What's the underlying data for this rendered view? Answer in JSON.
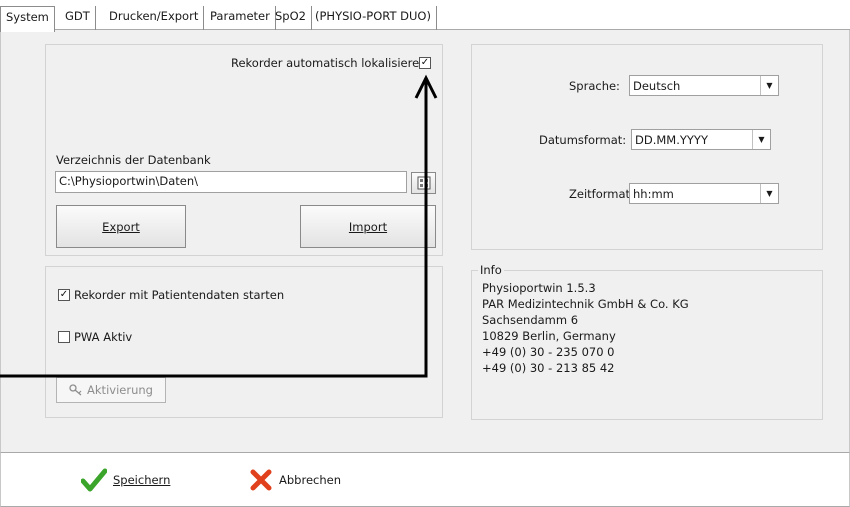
{
  "tabs": [
    {
      "label": "System",
      "active": true
    },
    {
      "label": "GDT"
    },
    {
      "label": "Drucken/Export"
    },
    {
      "label": "Parameter"
    },
    {
      "label": "SpO2"
    },
    {
      "label": "(PHYSIO-PORT DUO)"
    }
  ],
  "database": {
    "auto_locate_label": "Rekorder automatisch lokalisieren",
    "auto_locate_checked": true,
    "dir_label": "Verzeichnis der Datenbank",
    "dir_value": "C:\\Physioportwin\\Daten\\",
    "export_label": "Export",
    "import_label": "Import"
  },
  "options": {
    "start_with_patient_label": "Rekorder mit Patientendaten starten",
    "start_with_patient_checked": true,
    "pwa_label": "PWA Aktiv",
    "pwa_checked": false,
    "activation_label": "Aktivierung"
  },
  "settings": {
    "language_label": "Sprache:",
    "language_value": "Deutsch",
    "date_format_label": "Datumsformat:",
    "date_format_value": "DD.MM.YYYY",
    "time_format_label": "Zeitformat:",
    "time_format_value": "hh:mm"
  },
  "info": {
    "title": "Info",
    "lines": [
      "Physioportwin 1.5.3",
      "PAR Medizintechnik GmbH & Co. KG",
      "Sachsendamm 6",
      "10829 Berlin, Germany",
      "+49 (0) 30 - 235 070 0",
      "+49 (0) 30 - 213 85 42"
    ]
  },
  "footer": {
    "save_label": "Speichern",
    "cancel_label": "Abbrechen"
  },
  "colors": {
    "save_check": "#3aa52a",
    "cancel_x": "#e0401c",
    "annotation_arrow": "#000000"
  }
}
